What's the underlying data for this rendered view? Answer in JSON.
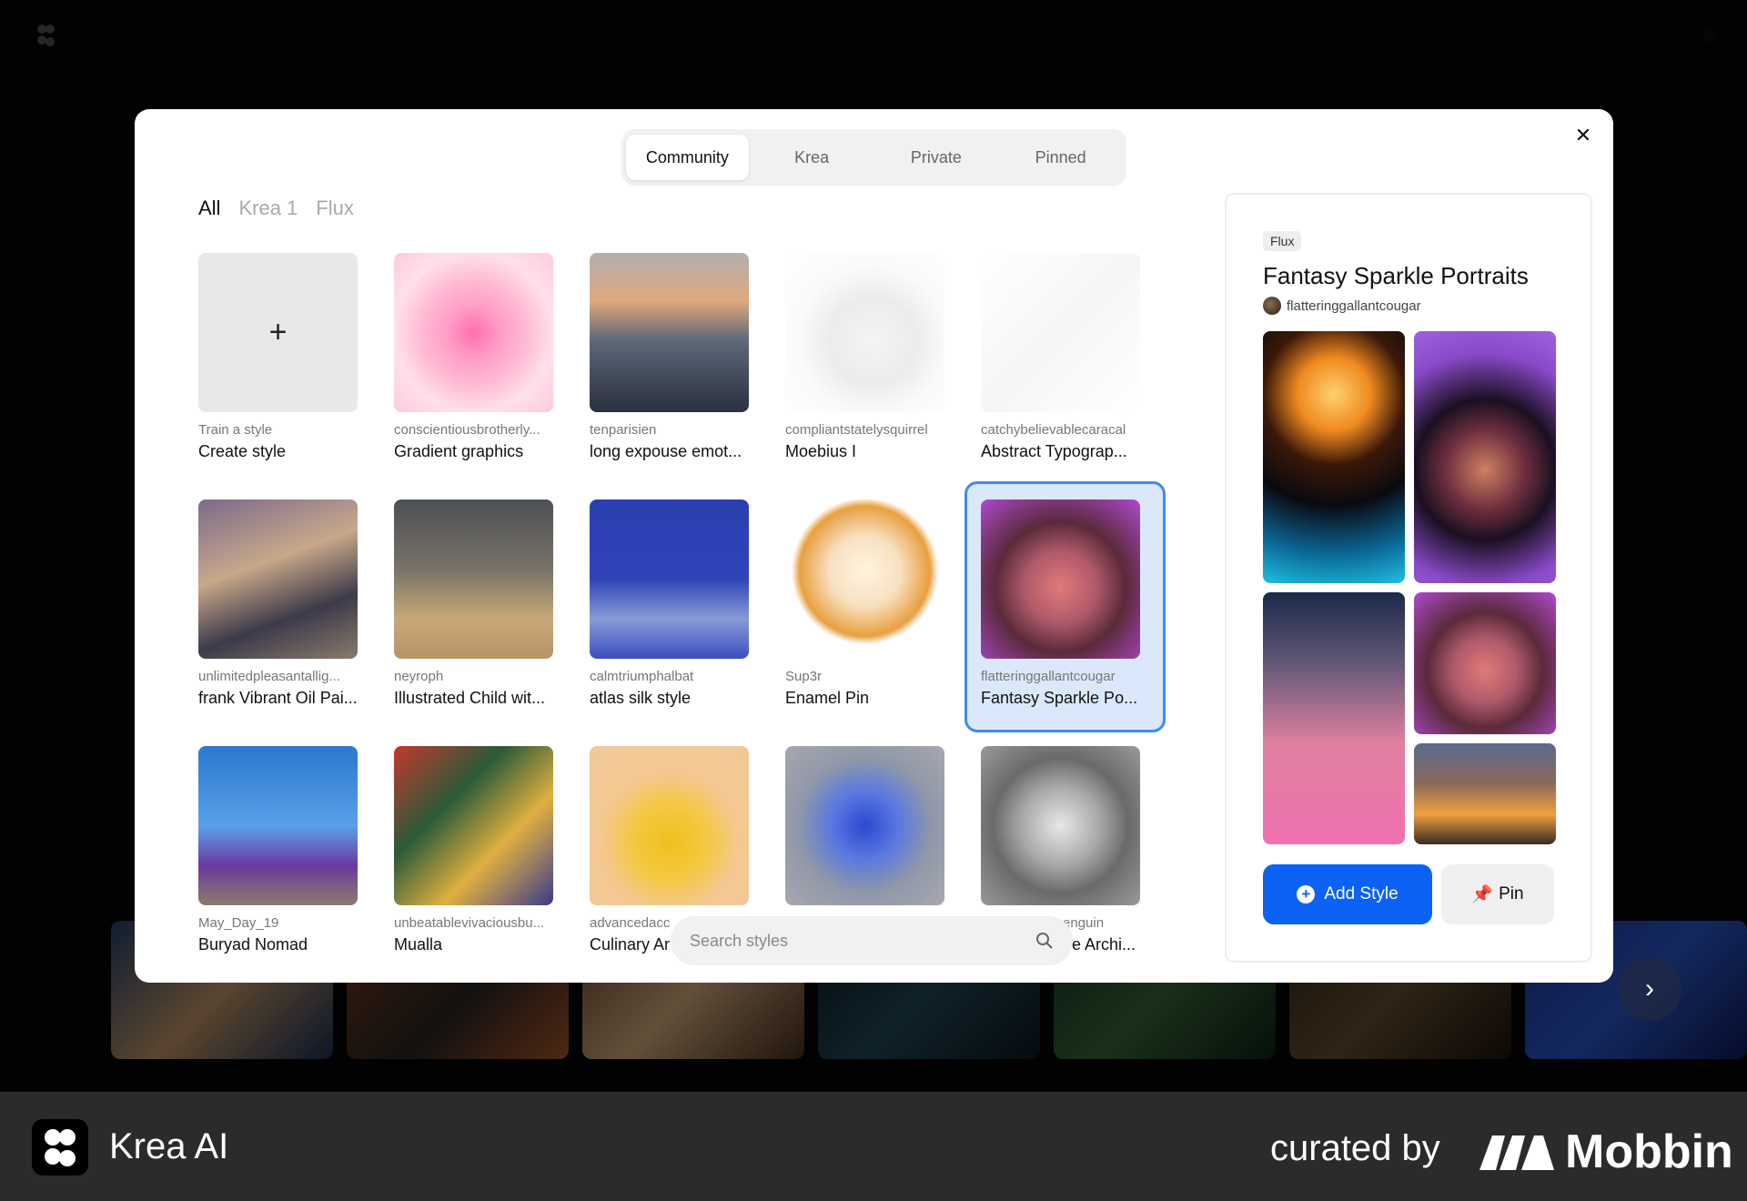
{
  "modal": {
    "tabs": [
      {
        "label": "Community"
      },
      {
        "label": "Krea"
      },
      {
        "label": "Private"
      },
      {
        "label": "Pinned"
      }
    ],
    "filters": [
      {
        "label": "All"
      },
      {
        "label": "Krea 1"
      },
      {
        "label": "Flux"
      }
    ],
    "close_icon": "close-icon",
    "create_card": {
      "user": "Train a style",
      "title": "Create style"
    },
    "cards": [
      {
        "user": "conscientiousbrotherly...",
        "title": "Gradient graphics"
      },
      {
        "user": "tenparisien",
        "title": "long expouse emot..."
      },
      {
        "user": "compliantstatelysquirrel",
        "title": "Moebius I"
      },
      {
        "user": "catchybelievablecaracal",
        "title": "Abstract Typograp..."
      },
      {
        "user": "unlimitedpleasantallig...",
        "title": "frank Vibrant Oil Pai..."
      },
      {
        "user": "neyroph",
        "title": "Illustrated Child wit..."
      },
      {
        "user": "calmtriumphalbat",
        "title": "atlas silk style"
      },
      {
        "user": "Sup3r",
        "title": "Enamel Pin"
      },
      {
        "user": "flatteringgallantcougar",
        "title": "Fantasy Sparkle Po..."
      },
      {
        "user": "May_Day_19",
        "title": "Buryad Nomad"
      },
      {
        "user": "unbeatablevivaciousbu...",
        "title": "Mualla"
      },
      {
        "user": "advancedacc",
        "title": "Culinary Ar"
      },
      {
        "user": "",
        "title": ""
      },
      {
        "user": "enguin",
        "title": "e Archi..."
      }
    ],
    "search": {
      "placeholder": "Search styles"
    },
    "detail": {
      "badge": "Flux",
      "title": "Fantasy Sparkle Portraits",
      "author": "flatteringgallantcougar",
      "add_label": "Add Style",
      "pin_label": "Pin"
    }
  },
  "footer": {
    "app_name": "Krea AI",
    "curated_by": "curated by",
    "brand": "Mobbin"
  },
  "colors": {
    "accent": "#0b62f5",
    "selected_border": "#3f8bf0",
    "selected_bg": "#dbe8fb"
  }
}
